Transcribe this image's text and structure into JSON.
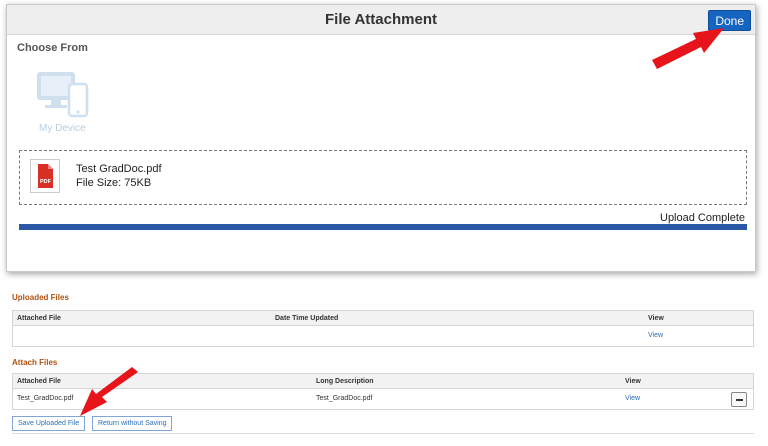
{
  "modal": {
    "title": "File Attachment",
    "done_label": "Done",
    "choose_from": "Choose From",
    "device_label": "My Device",
    "file": {
      "name": "Test GradDoc.pdf",
      "size": "File Size: 75KB",
      "icon_text": "PDF"
    },
    "upload_status": "Upload Complete",
    "upload_progress": 1.0
  },
  "uploaded_files": {
    "title": "Uploaded Files",
    "columns": [
      "Attached File",
      "Date Time Updated",
      "View"
    ],
    "rows": [
      {
        "attached_file": "",
        "date_time_updated": "",
        "view": "View"
      }
    ]
  },
  "attach_files": {
    "title": "Attach Files",
    "columns": [
      "Attached File",
      "Long Description",
      "View"
    ],
    "rows": [
      {
        "attached_file": "Test_GradDoc.pdf",
        "long_description": "Test_GradDoc.pdf",
        "view": "View"
      }
    ]
  },
  "actions": {
    "save_label": "Save Uploaded File",
    "return_label": "Return without Saving"
  },
  "colors": {
    "accent": "#1565c0",
    "section_title": "#b0520f",
    "link": "#2d6fb7",
    "annotation_arrow": "#e8141c",
    "pdf_icon": "#d93025"
  }
}
